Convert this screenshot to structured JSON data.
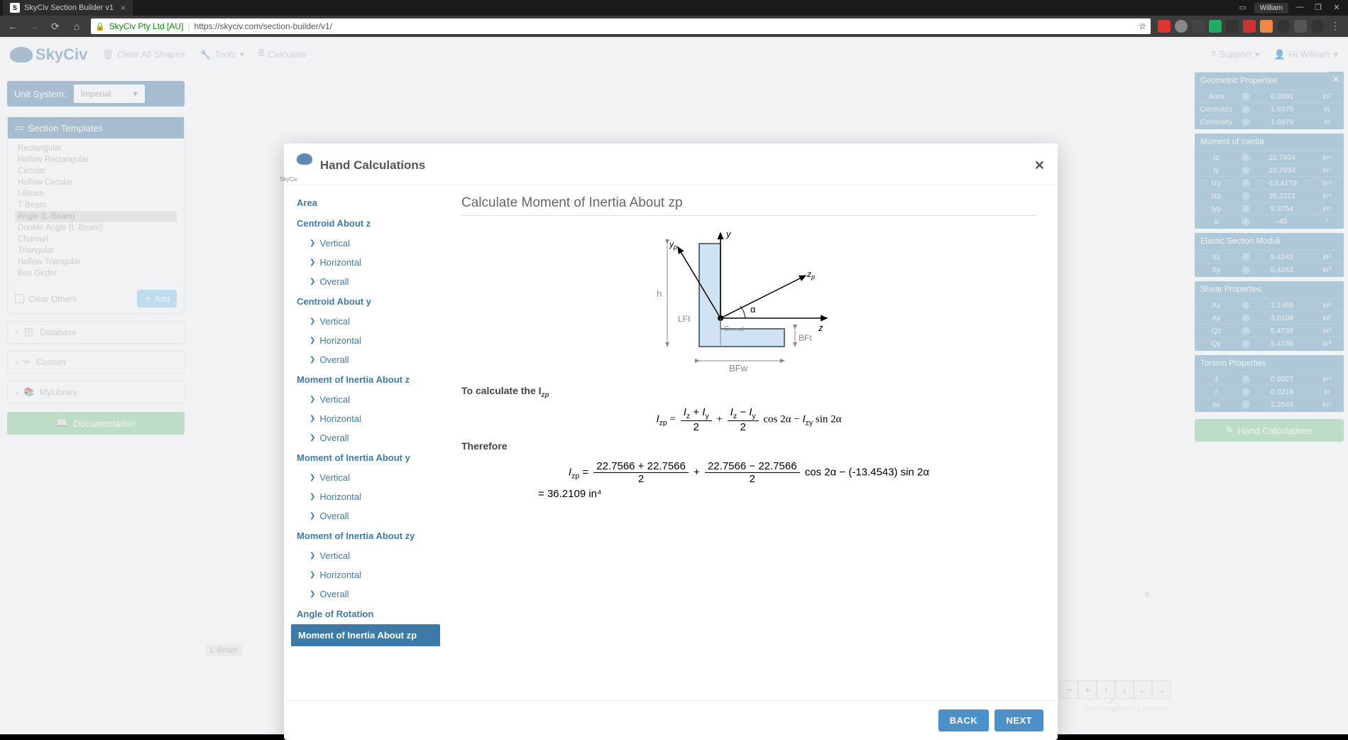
{
  "browser": {
    "tab_title": "SkyCiv Section Builder v1",
    "user": "William",
    "publisher": "SkyCiv Pty Ltd [AU]",
    "url": "https://skyciv.com/section-builder/v1/"
  },
  "topbar": {
    "brand": "SkyCiv",
    "clear_shapes": "Clear All Shapes",
    "tools": "Tools",
    "calculate": "Calculate",
    "support": "Support",
    "greeting": "Hi William"
  },
  "left": {
    "unit_label": "Unit System:",
    "unit_value": "Imperial",
    "section_templates_hd": "Section Templates",
    "templates": [
      "Rectangular",
      "Hollow Rectangular",
      "Circular",
      "Hollow Circular",
      "I-Beam",
      "T-Beam",
      "Angle (L-Beam)",
      "Double Angle (L-Beam)",
      "Channel",
      "Triangular",
      "Hollow Triangular",
      "Box Girder"
    ],
    "selected_template_index": 6,
    "clear_others": "Clear Others",
    "add": "Add",
    "database": "Database",
    "custom": "Custom",
    "mylibrary": "MyLibrary",
    "documentation": "Documentation"
  },
  "canvas": {
    "watermark": "SkyCiv",
    "watermark_sub": "Cloud Engineering Software",
    "tag": "L-Beam",
    "coord": "8"
  },
  "right": {
    "geo_hd": "Geometric Properties",
    "geo": [
      {
        "lab": "Area",
        "val": "6.9691",
        "unit": "in²"
      },
      {
        "lab": "Centroid z",
        "val": "1.6979",
        "unit": "in"
      },
      {
        "lab": "Centroid y",
        "val": "1.6979",
        "unit": "in"
      }
    ],
    "moi_hd": "Moment of Inertia",
    "moi": [
      {
        "lab": "Iz",
        "val": "22.7934",
        "unit": "in⁴"
      },
      {
        "lab": "Iy",
        "val": "22.7934",
        "unit": "in⁴"
      },
      {
        "lab": "Izy",
        "val": "-13.4179",
        "unit": "in⁴"
      },
      {
        "lab": "Izp",
        "val": "36.2113",
        "unit": "in⁴"
      },
      {
        "lab": "Iyp",
        "val": "9.3754",
        "unit": "in⁴"
      },
      {
        "lab": "α",
        "val": "-45",
        "unit": "°"
      }
    ],
    "esm_hd": "Elastic Section Moduli",
    "esm": [
      {
        "lab": "Sz",
        "val": "5.4242",
        "unit": "in³"
      },
      {
        "lab": "Sy",
        "val": "5.4242",
        "unit": "in³"
      }
    ],
    "shear_hd": "Shear Properties",
    "shear": [
      {
        "lab": "Az",
        "val": "3.1469",
        "unit": "in²"
      },
      {
        "lab": "Ay",
        "val": "3.0109",
        "unit": "in²"
      },
      {
        "lab": "Qz",
        "val": "5.4739",
        "unit": "in³"
      },
      {
        "lab": "Qy",
        "val": "5.4739",
        "unit": "in³"
      }
    ],
    "tors_hd": "Torsion Properties",
    "tors": [
      {
        "lab": "J",
        "val": "0.9027",
        "unit": "in⁴"
      },
      {
        "lab": "r",
        "val": "0.9219",
        "unit": "in"
      },
      {
        "lab": "Iw",
        "val": "2.2549",
        "unit": "in⁶"
      }
    ],
    "handcalc": "Hand Calculations"
  },
  "modal": {
    "title": "Hand Calculations",
    "nav": [
      {
        "type": "head",
        "label": "Area"
      },
      {
        "type": "head",
        "label": "Centroid About z"
      },
      {
        "type": "sub",
        "label": "Vertical"
      },
      {
        "type": "sub",
        "label": "Horizontal"
      },
      {
        "type": "sub",
        "label": "Overall"
      },
      {
        "type": "head",
        "label": "Centroid About y"
      },
      {
        "type": "sub",
        "label": "Vertical"
      },
      {
        "type": "sub",
        "label": "Horizontal"
      },
      {
        "type": "sub",
        "label": "Overall"
      },
      {
        "type": "head",
        "label": "Moment of Inertia About z"
      },
      {
        "type": "sub",
        "label": "Vertical"
      },
      {
        "type": "sub",
        "label": "Horizontal"
      },
      {
        "type": "sub",
        "label": "Overall"
      },
      {
        "type": "head",
        "label": "Moment of Inertia About y"
      },
      {
        "type": "sub",
        "label": "Vertical"
      },
      {
        "type": "sub",
        "label": "Horizontal"
      },
      {
        "type": "sub",
        "label": "Overall"
      },
      {
        "type": "head",
        "label": "Moment of Inertia About zy"
      },
      {
        "type": "sub",
        "label": "Vertical"
      },
      {
        "type": "sub",
        "label": "Horizontal"
      },
      {
        "type": "sub",
        "label": "Overall"
      },
      {
        "type": "head",
        "label": "Angle of Rotation"
      },
      {
        "type": "active",
        "label": "Moment of Inertia About zp"
      }
    ],
    "content_title": "Calculate Moment of Inertia About zp",
    "intro": "To calculate the I",
    "intro_sub": "zp",
    "therefore": "Therefore",
    "calc": {
      "iz": "22.7566",
      "iy": "22.7566",
      "izy": "-13.4543",
      "result": "36.2109",
      "unit": "in⁴"
    },
    "back": "BACK",
    "next": "NEXT"
  },
  "diagram_labels": {
    "y": "y",
    "yp": "yp",
    "z": "z",
    "zp": "zp",
    "h": "h",
    "alpha": "α",
    "lft": "LFt",
    "bft": "BFt",
    "bfw": "BFw",
    "coverall": "Coverall"
  }
}
